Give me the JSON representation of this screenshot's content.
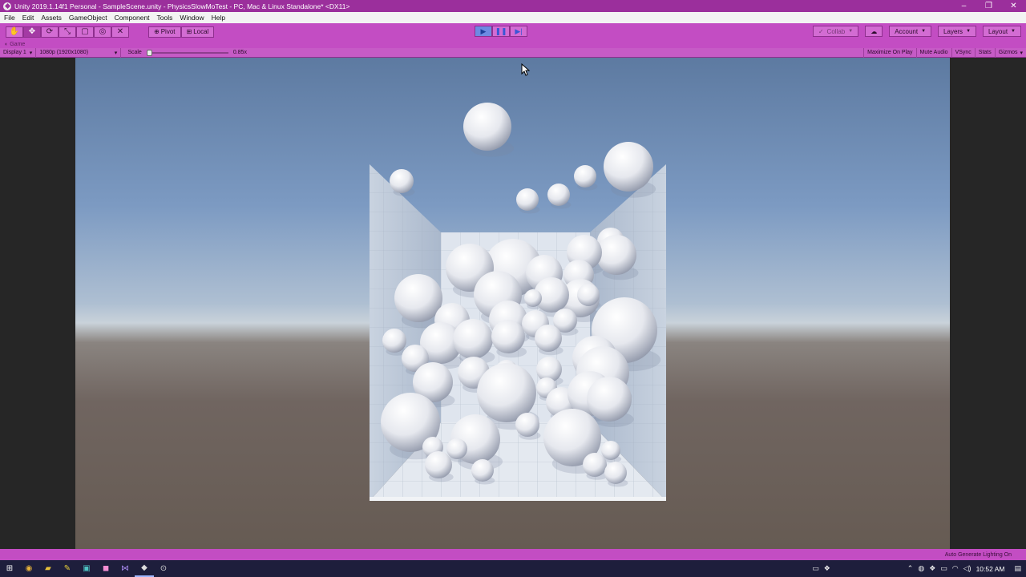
{
  "window": {
    "title": "Unity 2019.1.14f1 Personal - SampleScene.unity - PhysicsSlowMoTest - PC, Mac & Linux Standalone* <DX11>",
    "minimize": "–",
    "maximize": "❐",
    "close": "✕"
  },
  "menu": [
    "File",
    "Edit",
    "Assets",
    "GameObject",
    "Component",
    "Tools",
    "Window",
    "Help"
  ],
  "toolbar": {
    "tools": [
      "hand",
      "move",
      "rotate",
      "scale",
      "rect",
      "transform",
      "custom"
    ],
    "active_tool": "move",
    "pivot_label": "Pivot",
    "local_label": "Local",
    "play_state": "playing",
    "collab_label": "Collab",
    "account_label": "Account",
    "layers_label": "Layers",
    "layout_label": "Layout"
  },
  "game_tab": {
    "label": "Game"
  },
  "game_controls": {
    "display": "Display 1",
    "resolution": "1080p (1920x1080)",
    "scale_label": "Scale",
    "scale_value": "0.85x",
    "scale_fraction": 0.0,
    "maximize_on_play": "Maximize On Play",
    "mute_audio": "Mute Audio",
    "vsync": "VSync",
    "stats": "Stats",
    "gizmos": "Gizmos"
  },
  "status_bar": {
    "message": "Auto Generate Lighting On"
  },
  "taskbar": {
    "time": "10:52 AM",
    "apps": [
      "start",
      "chrome",
      "explorer",
      "pencil",
      "terminal",
      "recorder",
      "visual-studio",
      "unity",
      "unity-hub"
    ]
  },
  "colors": {
    "playmode_tint": "#c34dc3",
    "title_bar": "#9b2f9c",
    "play_active": "#6d8ae3"
  }
}
